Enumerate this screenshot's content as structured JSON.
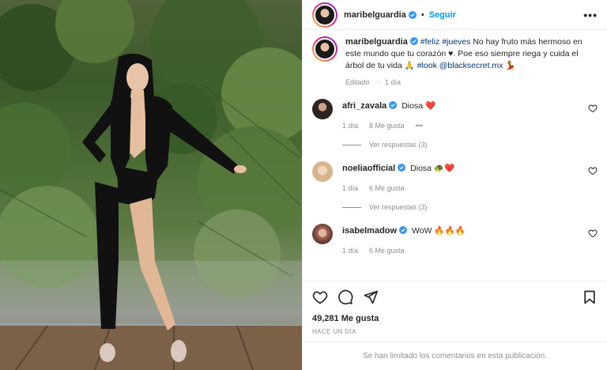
{
  "post": {
    "username": "maribelguardia",
    "follow_label": "Seguir",
    "more_label": "•••",
    "caption": {
      "hashtags": "#feliz #jueves",
      "text": " No hay fruto más hermoso en este mundo que tu corazón ♥. Poe eso siempre riega y cuida el árbol de tu vida 🙏 ",
      "tag2": "#look",
      "mention": "@blacksecret.mx",
      "emoji": "💃"
    },
    "caption_meta": [
      "Editado",
      "1 día"
    ],
    "likes": "49,281 Me gusta",
    "timestamp": "HACE UN DÍA",
    "comments_limited": "Se han limitado los comentarios en esta publicación."
  },
  "comments": [
    {
      "username": "afri_zavala",
      "text": "Diosa ❤️",
      "time": "1 día",
      "likes": "8 Me gusta",
      "more": "•••",
      "replies": "Ver respuestas (3)",
      "avatar_color": "#2b2420"
    },
    {
      "username": "noeliaofficial",
      "text": "Diosa 🐢❤️",
      "time": "1 día",
      "likes": "6 Me gusta",
      "replies": "Ver respuestas (3)",
      "avatar_color": "#d8b48a"
    },
    {
      "username": "isabelmadow",
      "text": "WoW 🔥🔥🔥",
      "time": "1 día",
      "likes": "6 Me gusta",
      "avatar_color": "#a86a5a"
    }
  ],
  "colors": {
    "accent": "#0095f6",
    "verified": "#3897f0",
    "muted": "#8e8e8e"
  }
}
